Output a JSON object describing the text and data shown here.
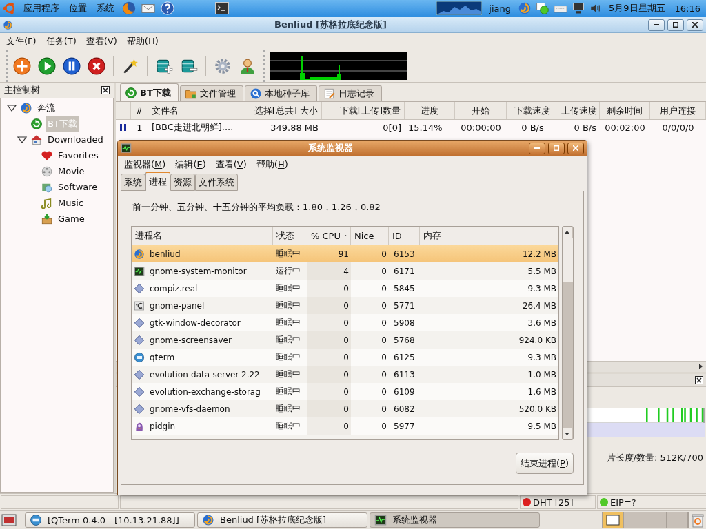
{
  "top_panel": {
    "menus": [
      "应用程序",
      "位置",
      "系统"
    ],
    "user": "jiang",
    "date": "5月9日星期五",
    "time": "16:16"
  },
  "main_window": {
    "title": "Benliud [苏格拉底纪念版]",
    "menus": [
      {
        "before": "文件(",
        "key": "F",
        "after": ")"
      },
      {
        "before": "任务(",
        "key": "T",
        "after": ")"
      },
      {
        "before": "查看(",
        "key": "V",
        "after": ")"
      },
      {
        "before": "帮助(",
        "key": "H",
        "after": ")"
      }
    ],
    "toolbar": [
      {
        "kind": "add"
      },
      {
        "kind": "play"
      },
      {
        "kind": "pause"
      },
      {
        "kind": "stop"
      },
      {
        "kind": "sep"
      },
      {
        "kind": "wand"
      },
      {
        "kind": "sep"
      },
      {
        "kind": "db-add"
      },
      {
        "kind": "db-remove"
      },
      {
        "kind": "sep"
      },
      {
        "kind": "settings"
      },
      {
        "kind": "user"
      }
    ],
    "tree": {
      "title": "主控制树",
      "items": [
        {
          "label": "奔流",
          "kind": "swirl",
          "expanded": true,
          "selected": false,
          "children": [
            {
              "label": "BT下载",
              "kind": "bt",
              "selected": true
            },
            {
              "label": "Downloaded",
              "kind": "house",
              "expanded": true,
              "selected": false,
              "children": [
                {
                  "label": "Favorites",
                  "kind": "heart",
                  "selected": false
                },
                {
                  "label": "Movie",
                  "kind": "film",
                  "selected": false
                },
                {
                  "label": "Software",
                  "kind": "software",
                  "selected": false
                },
                {
                  "label": "Music",
                  "kind": "music",
                  "selected": false
                },
                {
                  "label": "Game",
                  "kind": "game",
                  "selected": false
                }
              ]
            }
          ]
        }
      ]
    },
    "tabs": [
      {
        "label": "BT下载",
        "kind": "bt",
        "selected": true
      },
      {
        "label": "文件管理",
        "kind": "folder",
        "selected": false
      },
      {
        "label": "本地种子库",
        "kind": "search",
        "selected": false
      },
      {
        "label": "日志记录",
        "kind": "log",
        "selected": false
      }
    ],
    "table": {
      "columns": [
        "#",
        "文件名",
        "选择[总共] 大小",
        "下载[上传]数量",
        "进度",
        "开始",
        "下载速度",
        "上传速度",
        "剩余时间",
        "用户连接"
      ],
      "rows": [
        {
          "kind": "paused",
          "cells": [
            "1",
            "[BBC走进北朝鲜]....",
            "349.88 MB",
            "0[0]",
            "15.14%",
            "00:00:00",
            "0 B/s",
            "0 B/s",
            "00:02:00",
            "0/0/0/0"
          ]
        }
      ]
    },
    "details": {
      "info": "片长度/数量: 512K/700"
    },
    "status_bar": [
      {
        "label": "DHT [25]",
        "color": "#dd2020"
      },
      {
        "label": "EIP=?",
        "color": "#50c828"
      }
    ]
  },
  "monitor": {
    "title": "系统监视器",
    "menus": [
      {
        "before": "监视器(",
        "key": "M",
        "after": ")"
      },
      {
        "before": "编辑(",
        "key": "E",
        "after": ")"
      },
      {
        "before": "查看(",
        "key": "V",
        "after": ")"
      },
      {
        "before": "帮助(",
        "key": "H",
        "after": ")"
      }
    ],
    "tabs": [
      {
        "label": "系统",
        "selected": false
      },
      {
        "label": "进程",
        "selected": true
      },
      {
        "label": "资源",
        "selected": false
      },
      {
        "label": "文件系统",
        "selected": false
      }
    ],
    "load": "前一分钟、五分钟、十五分钟的平均负载：1.80，1.26，0.82",
    "columns": [
      {
        "label": "进程名",
        "sorted": false
      },
      {
        "label": "状态",
        "sorted": false
      },
      {
        "label": "% CPU",
        "sorted": true
      },
      {
        "label": "Nice",
        "sorted": false
      },
      {
        "label": "ID",
        "sorted": false
      },
      {
        "label": "内存",
        "sorted": false
      }
    ],
    "rows": [
      {
        "kind": "swirl",
        "name": "benliud",
        "state": "睡眠中",
        "cpu": "91",
        "nice": "0",
        "id": "6153",
        "memory": "12.2 MB",
        "selected": true
      },
      {
        "kind": "monitor",
        "name": "gnome-system-monitor",
        "state": "运行中",
        "cpu": "4",
        "nice": "0",
        "id": "6171",
        "memory": "5.5 MB",
        "selected": false
      },
      {
        "kind": "diamond",
        "name": "compiz.real",
        "state": "睡眠中",
        "cpu": "0",
        "nice": "0",
        "id": "5845",
        "memory": "9.3 MB",
        "selected": false
      },
      {
        "kind": "panel",
        "name": "gnome-panel",
        "state": "睡眠中",
        "cpu": "0",
        "nice": "0",
        "id": "5771",
        "memory": "26.4 MB",
        "selected": false
      },
      {
        "kind": "diamond",
        "name": "gtk-window-decorator",
        "state": "睡眠中",
        "cpu": "0",
        "nice": "0",
        "id": "5908",
        "memory": "3.6 MB",
        "selected": false
      },
      {
        "kind": "diamond",
        "name": "gnome-screensaver",
        "state": "睡眠中",
        "cpu": "0",
        "nice": "0",
        "id": "5768",
        "memory": "924.0 KB",
        "selected": false
      },
      {
        "kind": "qterm",
        "name": "qterm",
        "state": "睡眠中",
        "cpu": "0",
        "nice": "0",
        "id": "6125",
        "memory": "9.3 MB",
        "selected": false
      },
      {
        "kind": "diamond",
        "name": "evolution-data-server-2.22",
        "state": "睡眠中",
        "cpu": "0",
        "nice": "0",
        "id": "6113",
        "memory": "1.0 MB",
        "selected": false
      },
      {
        "kind": "diamond",
        "name": "evolution-exchange-storag",
        "state": "睡眠中",
        "cpu": "0",
        "nice": "0",
        "id": "6109",
        "memory": "1.6 MB",
        "selected": false
      },
      {
        "kind": "diamond",
        "name": "gnome-vfs-daemon",
        "state": "睡眠中",
        "cpu": "0",
        "nice": "0",
        "id": "6082",
        "memory": "520.0 KB",
        "selected": false
      },
      {
        "kind": "pidgin",
        "name": "pidgin",
        "state": "睡眠中",
        "cpu": "0",
        "nice": "0",
        "id": "5977",
        "memory": "9.5 MB",
        "selected": false
      }
    ],
    "end_button": {
      "before": "结束进程(",
      "key": "P",
      "after": ")"
    }
  },
  "taskbar": {
    "windows": [
      {
        "kind": "qterm",
        "label": "[QTerm 0.4.0 - [10.13.21.88]]",
        "selected": false
      },
      {
        "kind": "swirl",
        "label": "Benliud [苏格拉底纪念版]",
        "selected": false
      },
      {
        "kind": "monitor",
        "label": "系统监视器",
        "selected": true
      }
    ],
    "workspaces": [
      {
        "selected": true
      },
      {
        "selected": false
      },
      {
        "selected": false
      },
      {
        "selected": false
      }
    ]
  }
}
